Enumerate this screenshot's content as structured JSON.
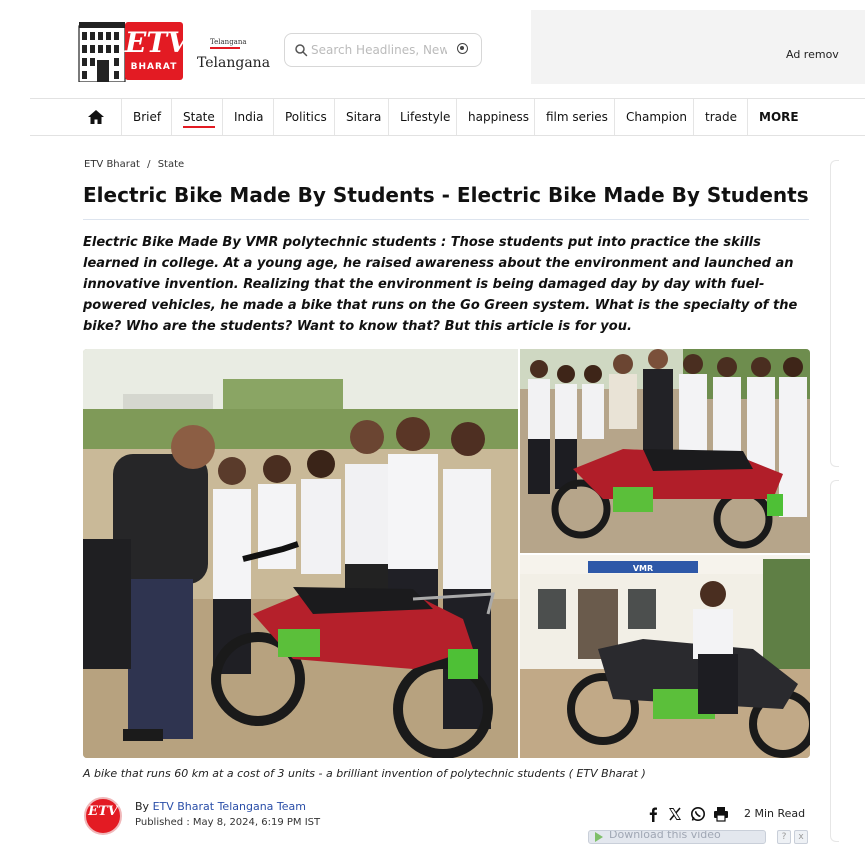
{
  "brand": {
    "logo_text": "ETV",
    "logo_subtext": "BHARAT",
    "region_small": "Telangana",
    "region_big": "Telangana"
  },
  "search": {
    "placeholder": "Search Headlines, News..."
  },
  "ad": {
    "text": "Ad remov"
  },
  "nav": {
    "items": [
      {
        "label": "Brief"
      },
      {
        "label": "State"
      },
      {
        "label": "India"
      },
      {
        "label": "Politics"
      },
      {
        "label": "Sitara"
      },
      {
        "label": "Lifestyle"
      },
      {
        "label": "happiness"
      },
      {
        "label": "film series"
      },
      {
        "label": "Champion"
      },
      {
        "label": "trade"
      },
      {
        "label": "MORE"
      }
    ],
    "active": "State"
  },
  "breadcrumb": {
    "home": "ETV Bharat",
    "separator": "/",
    "section": "State"
  },
  "article": {
    "title": "Electric Bike Made By Students - Electric Bike Made By Students",
    "summary": "Electric Bike Made By VMR polytechnic students : Those students put into practice the skills learned in college. At a young age, he raised awareness about the environment and launched an innovative invention. Realizing that the environment is being damaged day by day with fuel-powered vehicles, he made a bike that runs on the Go Green system. What is the specialty of the bike? Who are the students? Want to know that? But this article is for you.",
    "caption": "A bike that runs 60 km at a cost of 3 units - a brilliant invention of polytechnic students ( ETV Bharat )",
    "by_prefix": "By",
    "author": "ETV Bharat Telangana Team",
    "published": "Published : May 8, 2024, 6:19 PM IST",
    "read_time": "2 Min Read",
    "photo_sign": "VMR",
    "avatar_logo": "ETV"
  },
  "share": {
    "icons": [
      "facebook-icon",
      "x-icon",
      "whatsapp-icon",
      "print-icon"
    ]
  },
  "download": {
    "label": "Download this video",
    "help": "?",
    "close": "x"
  },
  "colors": {
    "brand_red": "#e31b23",
    "link_blue": "#2a4ea8"
  }
}
